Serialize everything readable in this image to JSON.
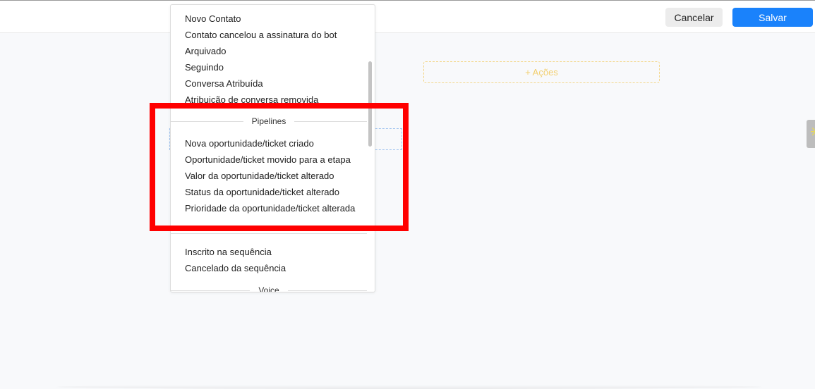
{
  "toolbar": {
    "cancel_label": "Cancelar",
    "save_label": "Salvar"
  },
  "canvas": {
    "actions_label": "+ Ações"
  },
  "dropdown": {
    "group1_items": [
      "Novo Contato",
      "Contato cancelou a assinatura do bot",
      "Arquivado",
      "Seguindo",
      "Conversa Atribuída",
      "Atribuição de conversa removida"
    ],
    "pipelines_header": "Pipelines",
    "pipelines_items": [
      "Nova oportunidade/ticket criado",
      "Oportunidade/ticket movido para a etapa",
      "Valor da oportunidade/ticket alterado",
      "Status da oportunidade/ticket alterado",
      "Prioridade da oportunidade/ticket alterada"
    ],
    "sequence_items": [
      "Inscrito na sequência",
      "Cancelado da sequência"
    ],
    "voice_header": "Voice"
  },
  "colors": {
    "save_button": "#1a82fb",
    "highlight": "#ff0000",
    "actions_dashed": "#f2cf6f"
  }
}
